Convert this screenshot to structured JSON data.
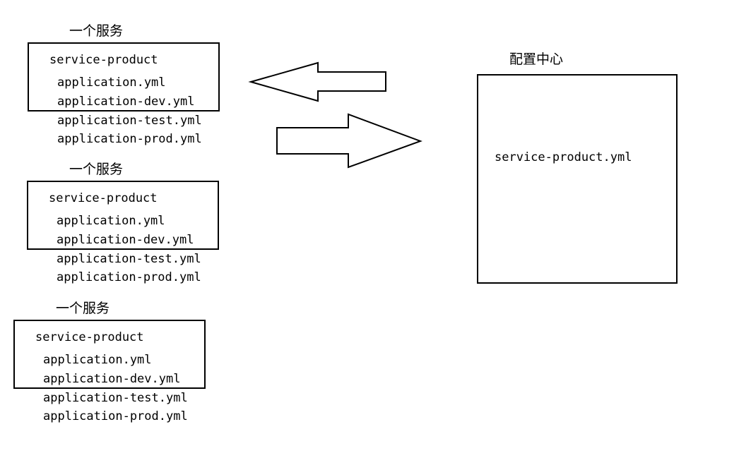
{
  "services": [
    {
      "title": "一个服务",
      "name": "service-product",
      "files": [
        "application.yml",
        "application-dev.yml",
        "application-test.yml",
        "application-prod.yml"
      ]
    },
    {
      "title": "一个服务",
      "name": "service-product",
      "files": [
        "application.yml",
        "application-dev.yml",
        "application-test.yml",
        "application-prod.yml"
      ]
    },
    {
      "title": "一个服务",
      "name": "service-product",
      "files": [
        "application.yml",
        "application-dev.yml",
        "application-test.yml",
        "application-prod.yml"
      ]
    }
  ],
  "config_center": {
    "title": "配置中心",
    "file": "service-product.yml"
  },
  "arrows": [
    {
      "icon": "arrow-left-icon",
      "direction": "left"
    },
    {
      "icon": "arrow-right-icon",
      "direction": "right"
    }
  ],
  "colors": {
    "stroke": "#000000",
    "background": "#ffffff"
  }
}
